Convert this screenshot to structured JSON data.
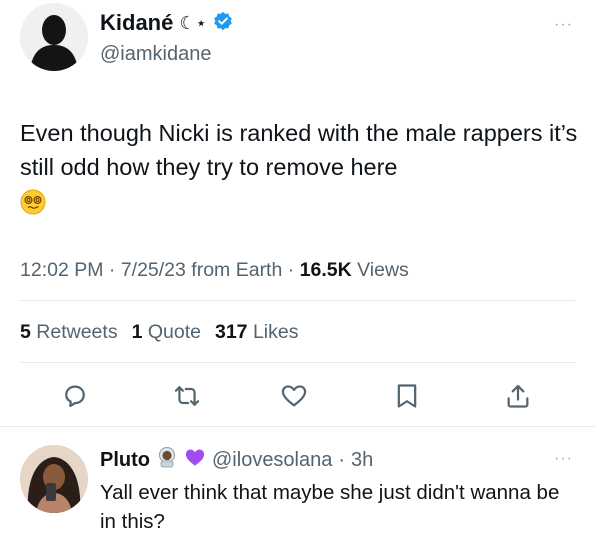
{
  "tweet": {
    "author_name": "Kidané",
    "author_name_decoration": "☾⋆",
    "author_handle": "@iamkidane",
    "more_label": "···",
    "text": "Even though Nicki is ranked with the male rappers it’s still odd how they try to remove here",
    "emoji_name": "face-with-spiral-eyes",
    "time": "12:02 PM",
    "date": "7/25/23",
    "source": "from Earth",
    "views_count": "16.5K",
    "views_label": "Views",
    "retweets_count": "5",
    "retweets_label": "Retweets",
    "quotes_count": "1",
    "quotes_label": "Quote",
    "likes_count": "317",
    "likes_label": "Likes"
  },
  "actions": [
    {
      "name": "reply-icon"
    },
    {
      "name": "retweet-icon"
    },
    {
      "name": "like-icon"
    },
    {
      "name": "bookmark-icon"
    },
    {
      "name": "share-icon"
    }
  ],
  "reply": {
    "author_name": "Pluto",
    "badges": [
      "astronaut-emoji",
      "purple-heart-emoji"
    ],
    "author_handle": "@ilovesolana",
    "separator": "·",
    "time": "3h",
    "more_label": "···",
    "text": "Yall ever think that maybe she just didn't wanna be in this?"
  },
  "colors": {
    "text": "#0f1419",
    "secondary": "#536471",
    "verified": "#1d9bf0",
    "divider": "#e7e9ea",
    "purple_heart": "#a24bf2"
  }
}
